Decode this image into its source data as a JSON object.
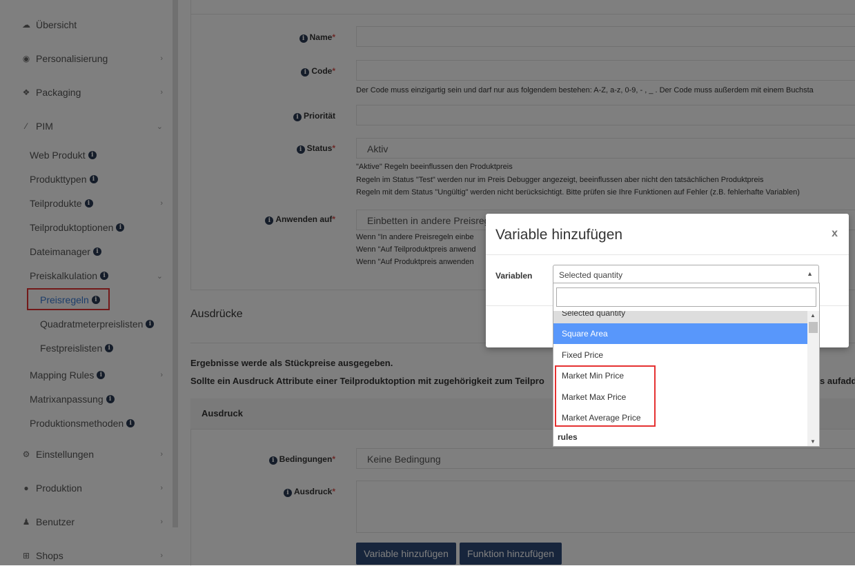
{
  "sidebar": {
    "items": [
      {
        "label": "Übersicht",
        "icon": "cloud-icon"
      },
      {
        "label": "Personalisierung",
        "icon": "eye-icon"
      },
      {
        "label": "Packaging",
        "icon": "boxes-icon"
      },
      {
        "label": "PIM",
        "icon": "magic-wand-icon"
      },
      {
        "label": "Einstellungen",
        "icon": "cogs-icon"
      },
      {
        "label": "Produktion",
        "icon": "production-icon"
      },
      {
        "label": "Benutzer",
        "icon": "user-icon"
      },
      {
        "label": "Shops",
        "icon": "cart-icon"
      }
    ],
    "pim_sub": [
      {
        "label": "Web Produkt"
      },
      {
        "label": "Produkttypen"
      },
      {
        "label": "Teilprodukte"
      },
      {
        "label": "Teilproduktoptionen"
      },
      {
        "label": "Dateimanager"
      },
      {
        "label": "Preiskalkulation"
      }
    ],
    "preis_sub": [
      {
        "label": "Preisregeln"
      },
      {
        "label": "Quadratmeterpreislisten"
      },
      {
        "label": "Festpreislisten"
      }
    ],
    "pim_sub_after": [
      {
        "label": "Mapping Rules"
      },
      {
        "label": "Matrixanpassung"
      },
      {
        "label": "Produktionsmethoden"
      }
    ]
  },
  "form": {
    "name_label": "Name",
    "code_label": "Code",
    "code_help": "Der Code muss einzigartig sein und darf nur aus folgendem bestehen: A-Z, a-z, 0-9, - , _ . Der Code muss außerdem mit einem Buchsta",
    "prioritaet_label": "Priorität",
    "status_label": "Status",
    "status_value": "Aktiv",
    "status_help": [
      "\"Aktive\" Regeln beeinflussen den Produktpreis",
      "Regeln im Status \"Test\" werden nur im Preis Debugger angezeigt, beeinflussen aber nicht den tatsächlichen Produktpreis",
      "Regeln mit dem Status \"Ungültig\" werden nicht berücksichtigt. Bitte prüfen sie Ihre Funktionen auf Fehler (z.B. fehlerhafte Variablen)"
    ],
    "anwenden_label": "Anwenden auf",
    "anwenden_value": "Einbetten in andere Preisreg",
    "anwenden_help": [
      "Wenn \"In andere Preisregeln einbe",
      "Wenn \"Auf Teilproduktpreis anwend",
      "Wenn \"Auf Produktpreis anwenden"
    ],
    "required_mark": "*"
  },
  "ausdruecke": {
    "title": "Ausdrücke",
    "line1": "Ergebnisse werde als Stückpreise ausgegeben.",
    "line2": "Sollte ein Ausdruck Attribute einer Teilproduktoption mit zugehörigkeit zum Teilpro",
    "line2_tail": "s aufadd",
    "panel_title": "Ausdruck",
    "bedingungen_label": "Bedingungen",
    "bedingungen_value": "Keine Bedingung",
    "ausdruck_label": "Ausdruck",
    "btn_variable": "Variable hinzufügen",
    "btn_funktion": "Funktion hinzufügen"
  },
  "modal": {
    "title": "Variable hinzufügen",
    "close": "x",
    "variablen_label": "Variablen",
    "selected": "Selected quantity",
    "search_value": "",
    "options": [
      {
        "label": "Selected quantity",
        "state": "current"
      },
      {
        "label": "Square Area",
        "state": "highlighted"
      },
      {
        "label": "Fixed Price",
        "state": "normal"
      },
      {
        "label": "Market Min Price",
        "state": "normal"
      },
      {
        "label": "Market Max Price",
        "state": "normal"
      },
      {
        "label": "Market Average Price",
        "state": "normal"
      },
      {
        "label": "rules",
        "state": "group"
      }
    ]
  },
  "colors": {
    "accent": "#2f4a78",
    "highlight_option": "#5897fb",
    "annotation_red": "#e53030",
    "active_link": "#3a7bd5"
  }
}
